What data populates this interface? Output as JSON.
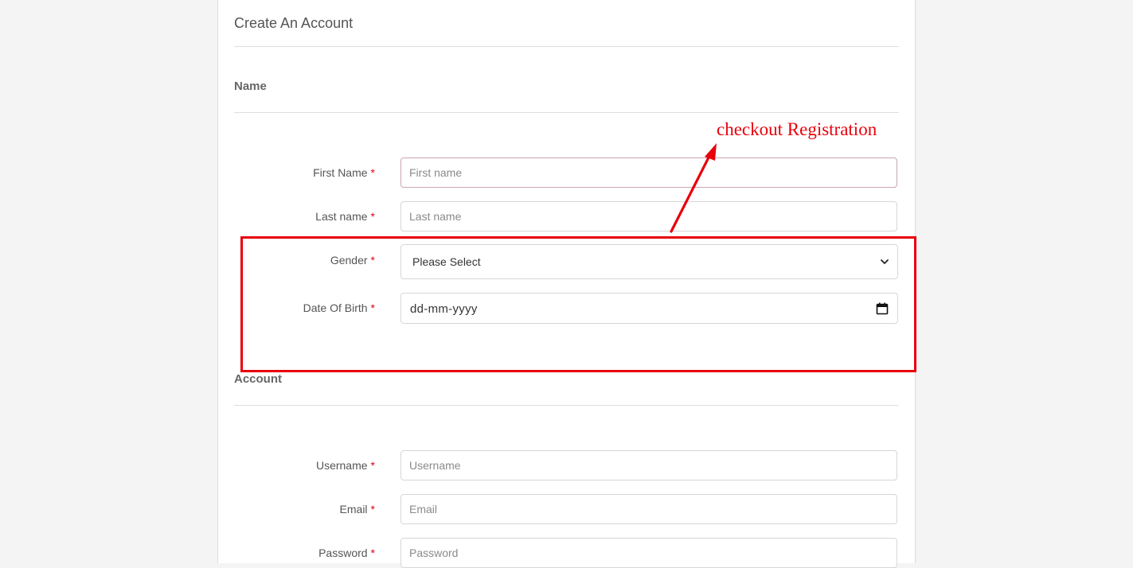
{
  "form": {
    "title": "Create An Account",
    "sections": {
      "name": "Name",
      "account": "Account"
    },
    "fields": {
      "first_name": {
        "label": "First Name",
        "required": "*",
        "placeholder": "First name"
      },
      "last_name": {
        "label": "Last name",
        "required": "*",
        "placeholder": "Last name"
      },
      "gender": {
        "label": "Gender",
        "required": "*",
        "value": "Please Select"
      },
      "dob": {
        "label": "Date Of Birth",
        "required": "*",
        "value": "dd-mm-yyyy"
      },
      "username": {
        "label": "Username",
        "required": "*",
        "placeholder": "Username"
      },
      "email": {
        "label": "Email",
        "required": "*",
        "placeholder": "Email"
      },
      "password": {
        "label": "Password",
        "required": "*",
        "placeholder": "Password"
      }
    }
  },
  "annotation": {
    "text": "checkout Registration",
    "color": "#e8000b"
  },
  "icons": {
    "gender_select": "chevron-down-icon",
    "dob_picker": "calendar-icon"
  }
}
